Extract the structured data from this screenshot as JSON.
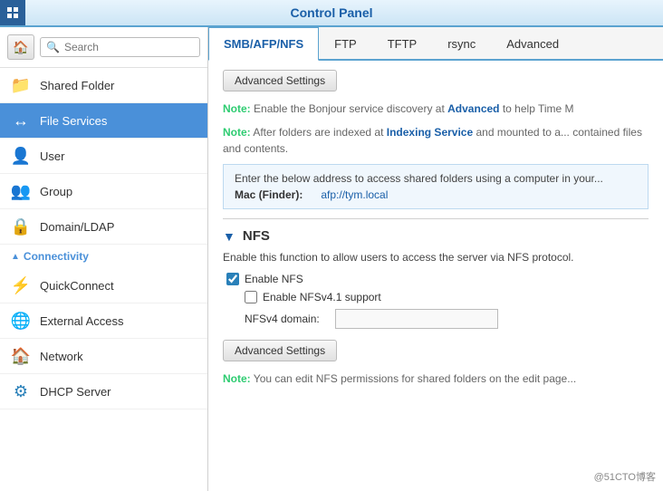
{
  "titleBar": {
    "title": "Control Panel"
  },
  "sidebar": {
    "searchPlaceholder": "Search",
    "items": [
      {
        "id": "shared-folder",
        "label": "Shared Folder",
        "icon": "folder-icon",
        "active": false
      },
      {
        "id": "file-services",
        "label": "File Services",
        "icon": "file-services-icon",
        "active": true
      },
      {
        "id": "user",
        "label": "User",
        "icon": "user-icon",
        "active": false
      },
      {
        "id": "group",
        "label": "Group",
        "icon": "group-icon",
        "active": false
      },
      {
        "id": "domain-ldap",
        "label": "Domain/LDAP",
        "icon": "domain-icon",
        "active": false
      }
    ],
    "connectivityHeader": "Connectivity",
    "connectivityItems": [
      {
        "id": "quickconnect",
        "label": "QuickConnect",
        "icon": "quickconnect-icon"
      },
      {
        "id": "external-access",
        "label": "External Access",
        "icon": "external-icon"
      },
      {
        "id": "network",
        "label": "Network",
        "icon": "network-icon"
      },
      {
        "id": "dhcp-server",
        "label": "DHCP Server",
        "icon": "dhcp-icon"
      }
    ]
  },
  "tabs": [
    {
      "id": "smb-afp-nfs",
      "label": "SMB/AFP/NFS",
      "active": true
    },
    {
      "id": "ftp",
      "label": "FTP",
      "active": false
    },
    {
      "id": "tftp",
      "label": "TFTP",
      "active": false
    },
    {
      "id": "rsync",
      "label": "rsync",
      "active": false
    },
    {
      "id": "advanced",
      "label": "Advanced",
      "active": false
    }
  ],
  "content": {
    "advancedSettingsBtn": "Advanced Settings",
    "note1": {
      "prefix": "Note:",
      "text": " Enable the Bonjour service discovery at ",
      "link": "Advanced",
      "suffix": " to help Time M"
    },
    "note2": {
      "prefix": "Note:",
      "text": " After folders are indexed at ",
      "link": "Indexing Service",
      "suffix": " and mounted to a... contained files and contents."
    },
    "infoBox": {
      "desc": "Enter the below address to access shared folders using a computer in your...",
      "macLabel": "Mac (Finder):",
      "macValue": "afp://tym.local"
    },
    "nfsSection": {
      "title": "NFS",
      "description": "Enable this function to allow users to access the server via NFS protocol.",
      "enableNfsLabel": "Enable NFS",
      "enableNfsv4Label": "Enable NFSv4.1 support",
      "nfsv4DomainLabel": "NFSv4 domain:",
      "advancedSettingsBtn": "Advanced Settings",
      "note": "Note: You can edit NFS permissions for shared folders on the edit page..."
    }
  },
  "watermark": "@51CTO博客"
}
